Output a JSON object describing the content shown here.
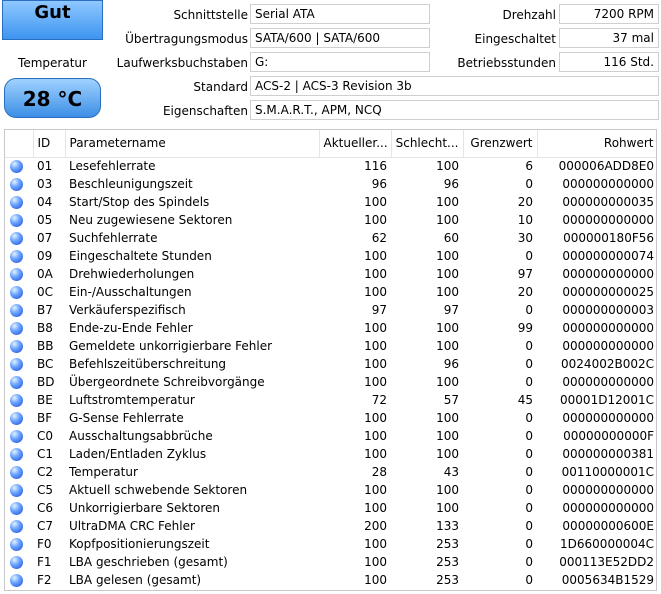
{
  "status": {
    "health": "Gut",
    "temp_label": "Temperatur",
    "temp_value": "28 °C"
  },
  "info": {
    "schnittstelle_label": "Schnittstelle",
    "schnittstelle_value": "Serial ATA",
    "transfer_label": "Übertragungsmodus",
    "transfer_value": "SATA/600 | SATA/600",
    "laufwerk_label": "Laufwerksbuchstaben",
    "laufwerk_value": "G:",
    "standard_label": "Standard",
    "standard_value": "ACS-2 | ACS-3 Revision 3b",
    "eigenschaften_label": "Eigenschaften",
    "eigenschaften_value": "S.M.A.R.T., APM, NCQ",
    "drehzahl_label": "Drehzahl",
    "drehzahl_value": "7200 RPM",
    "eingeschaltet_label": "Eingeschaltet",
    "eingeschaltet_value": "37 mal",
    "betriebsstunden_label": "Betriebsstunden",
    "betriebsstunden_value": "116 Std."
  },
  "table": {
    "headers": [
      "",
      "ID",
      "Parametername",
      "Aktueller...",
      "Schlecht...",
      "Grenzwert",
      "Rohwert"
    ],
    "rows": [
      [
        "01",
        "Lesefehlerrate",
        "116",
        "100",
        "6",
        "000006ADD8E0"
      ],
      [
        "03",
        "Beschleunigungszeit",
        "96",
        "96",
        "0",
        "000000000000"
      ],
      [
        "04",
        "Start/Stop des Spindels",
        "100",
        "100",
        "20",
        "000000000035"
      ],
      [
        "05",
        "Neu zugewiesene Sektoren",
        "100",
        "100",
        "10",
        "000000000000"
      ],
      [
        "07",
        "Suchfehlerrate",
        "62",
        "60",
        "30",
        "000000180F56"
      ],
      [
        "09",
        "Eingeschaltete Stunden",
        "100",
        "100",
        "0",
        "000000000074"
      ],
      [
        "0A",
        "Drehwiederholungen",
        "100",
        "100",
        "97",
        "000000000000"
      ],
      [
        "0C",
        "Ein-/Ausschaltungen",
        "100",
        "100",
        "20",
        "000000000025"
      ],
      [
        "B7",
        "Verkäuferspezifisch",
        "97",
        "97",
        "0",
        "000000000003"
      ],
      [
        "B8",
        "Ende-zu-Ende Fehler",
        "100",
        "100",
        "99",
        "000000000000"
      ],
      [
        "BB",
        "Gemeldete unkorrigierbare Fehler",
        "100",
        "100",
        "0",
        "000000000000"
      ],
      [
        "BC",
        "Befehlszeitüberschreitung",
        "100",
        "96",
        "0",
        "0024002B002C"
      ],
      [
        "BD",
        "Übergeordnete Schreibvorgänge",
        "100",
        "100",
        "0",
        "000000000000"
      ],
      [
        "BE",
        "Luftstromtemperatur",
        "72",
        "57",
        "45",
        "00001D12001C"
      ],
      [
        "BF",
        "G-Sense Fehlerrate",
        "100",
        "100",
        "0",
        "000000000000"
      ],
      [
        "C0",
        "Ausschaltungsabbrüche",
        "100",
        "100",
        "0",
        "00000000000F"
      ],
      [
        "C1",
        "Laden/Entladen Zyklus",
        "100",
        "100",
        "0",
        "000000000381"
      ],
      [
        "C2",
        "Temperatur",
        "28",
        "43",
        "0",
        "00110000001C"
      ],
      [
        "C5",
        "Aktuell schwebende Sektoren",
        "100",
        "100",
        "0",
        "000000000000"
      ],
      [
        "C6",
        "Unkorrigierbare Sektoren",
        "100",
        "100",
        "0",
        "000000000000"
      ],
      [
        "C7",
        "UltraDMA CRC Fehler",
        "200",
        "133",
        "0",
        "00000000600E"
      ],
      [
        "F0",
        "Kopfpositionierungszeit",
        "100",
        "253",
        "0",
        "1D660000004C"
      ],
      [
        "F1",
        "LBA geschrieben (gesamt)",
        "100",
        "253",
        "0",
        "000113E52DD2"
      ],
      [
        "F2",
        "LBA gelesen (gesamt)",
        "100",
        "253",
        "0",
        "0005634B1529"
      ]
    ]
  },
  "colors": {
    "status_good": "#3d95f0",
    "dot": "#1d46d8"
  },
  "icons": {
    "row_status": "blue-status-dot-icon"
  }
}
